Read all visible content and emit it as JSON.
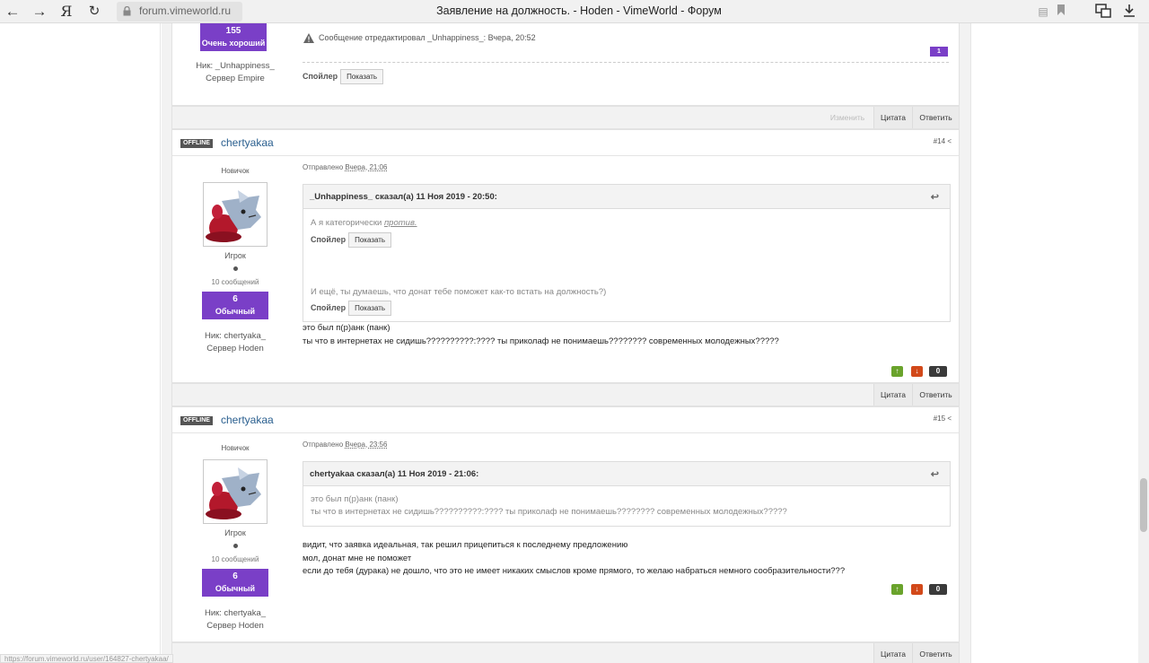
{
  "browser": {
    "url": "forum.vimeworld.ru",
    "title": "Заявление на должность. - Hoden - VimeWorld - Форум",
    "search_engine": "Я",
    "status_url": "https://forum.vimeworld.ru/user/164827-chertyakaa/"
  },
  "prev_post": {
    "rep_count": "155",
    "rep_label": "Очень хороший",
    "nick": "Ник: _Unhappiness_",
    "server": "Сервер Empire",
    "edited": "Сообщение отредактировал _Unhappiness_: Вчера, 20:52",
    "badge": "1",
    "spoiler_label": "Спойлер",
    "spoiler_btn": "Показать",
    "footer": {
      "edit": "Изменить",
      "quote": "Цитата",
      "reply": "Ответить"
    }
  },
  "post14": {
    "status": "OFFLINE",
    "username": "chertyakaa",
    "number": "#14",
    "rank": "Новичок",
    "group": "Игрок",
    "post_count": "10 сообщений",
    "rep_count": "6",
    "rep_label": "Обычный",
    "nick": "Ник: chertyaka_",
    "server": "Сервер Hoden",
    "posted_prefix": "Отправлено",
    "posted_time": "Вчера, 21:06",
    "quote_header": "_Unhappiness_ сказал(а) 11 Ноя 2019 - 20:50:",
    "quote_line1": "А я категорически ",
    "quote_line1_em": "против.",
    "quote_line2": "И ещё, ты думаешь, что донат тебе поможет как-то встать на должность?)",
    "spoiler_label": "Спойлер",
    "spoiler_btn": "Показать",
    "body_line1": "это был п(р)анк (панк)",
    "body_line2": "ты что в интернетах не сидишь??????????:???? ты приколаф не понимаешь???????? современных молодежных?????",
    "votes": "0",
    "footer": {
      "quote": "Цитата",
      "reply": "Ответить"
    }
  },
  "post15": {
    "status": "OFFLINE",
    "username": "chertyakaa",
    "number": "#15",
    "rank": "Новичок",
    "group": "Игрок",
    "post_count": "10 сообщений",
    "rep_count": "6",
    "rep_label": "Обычный",
    "nick": "Ник: chertyaka_",
    "server": "Сервер Hoden",
    "posted_prefix": "Отправлено",
    "posted_time": "Вчера, 23:56",
    "quote_header": "chertyakaa сказал(а) 11 Ноя 2019 - 21:06:",
    "quote_line1": "это был п(р)анк (панк)",
    "quote_line2": "ты что в интернетах не сидишь??????????:???? ты приколаф не понимаешь???????? современных молодежных?????",
    "body_line1": "видит, что заявка идеальная, так решил прицепиться к последнему предложению",
    "body_line2": "мол, донат мне не поможет",
    "body_line3": "если до тебя (дурака) не дошло, что это не имеет никаких смыслов кроме прямого, то желаю набраться немного сообразительности???",
    "votes": "0",
    "footer": {
      "quote": "Цитата",
      "reply": "Ответить"
    }
  },
  "colors": {
    "accent": "#7a3fc7",
    "upvote": "#6aa32c",
    "downvote": "#d2491a",
    "link": "#2a5f8f"
  }
}
